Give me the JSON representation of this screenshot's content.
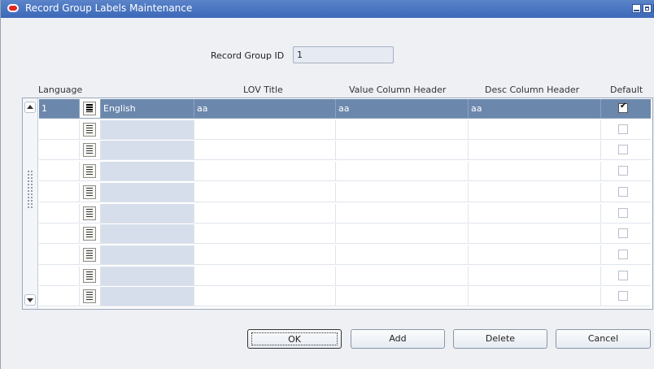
{
  "window": {
    "title": "Record Group Labels Maintenance"
  },
  "form": {
    "record_group_id_label": "Record Group ID",
    "record_group_id_value": "1"
  },
  "columns": {
    "language": "Language",
    "lov_title": "LOV Title",
    "value_header": "Value Column Header",
    "desc_header": "Desc Column Header",
    "default": "Default"
  },
  "rows": [
    {
      "code": "1",
      "language": "English",
      "lov_title": "aa",
      "value_header": "aa",
      "desc_header": "aa",
      "default": true
    },
    {
      "code": "",
      "language": "",
      "lov_title": "",
      "value_header": "",
      "desc_header": "",
      "default": false
    },
    {
      "code": "",
      "language": "",
      "lov_title": "",
      "value_header": "",
      "desc_header": "",
      "default": false
    },
    {
      "code": "",
      "language": "",
      "lov_title": "",
      "value_header": "",
      "desc_header": "",
      "default": false
    },
    {
      "code": "",
      "language": "",
      "lov_title": "",
      "value_header": "",
      "desc_header": "",
      "default": false
    },
    {
      "code": "",
      "language": "",
      "lov_title": "",
      "value_header": "",
      "desc_header": "",
      "default": false
    },
    {
      "code": "",
      "language": "",
      "lov_title": "",
      "value_header": "",
      "desc_header": "",
      "default": false
    },
    {
      "code": "",
      "language": "",
      "lov_title": "",
      "value_header": "",
      "desc_header": "",
      "default": false
    },
    {
      "code": "",
      "language": "",
      "lov_title": "",
      "value_header": "",
      "desc_header": "",
      "default": false
    },
    {
      "code": "",
      "language": "",
      "lov_title": "",
      "value_header": "",
      "desc_header": "",
      "default": false
    }
  ],
  "buttons": {
    "ok": "OK",
    "add": "Add",
    "delete": "Delete",
    "cancel": "Cancel"
  },
  "colors": {
    "title_bar": "#3c68b8",
    "selected_row": "#6b87ac",
    "language_cell": "#d6deeb"
  },
  "icons": {
    "lov_button": "list-of-values-icon",
    "app_logo": "oracle-logo-icon"
  }
}
